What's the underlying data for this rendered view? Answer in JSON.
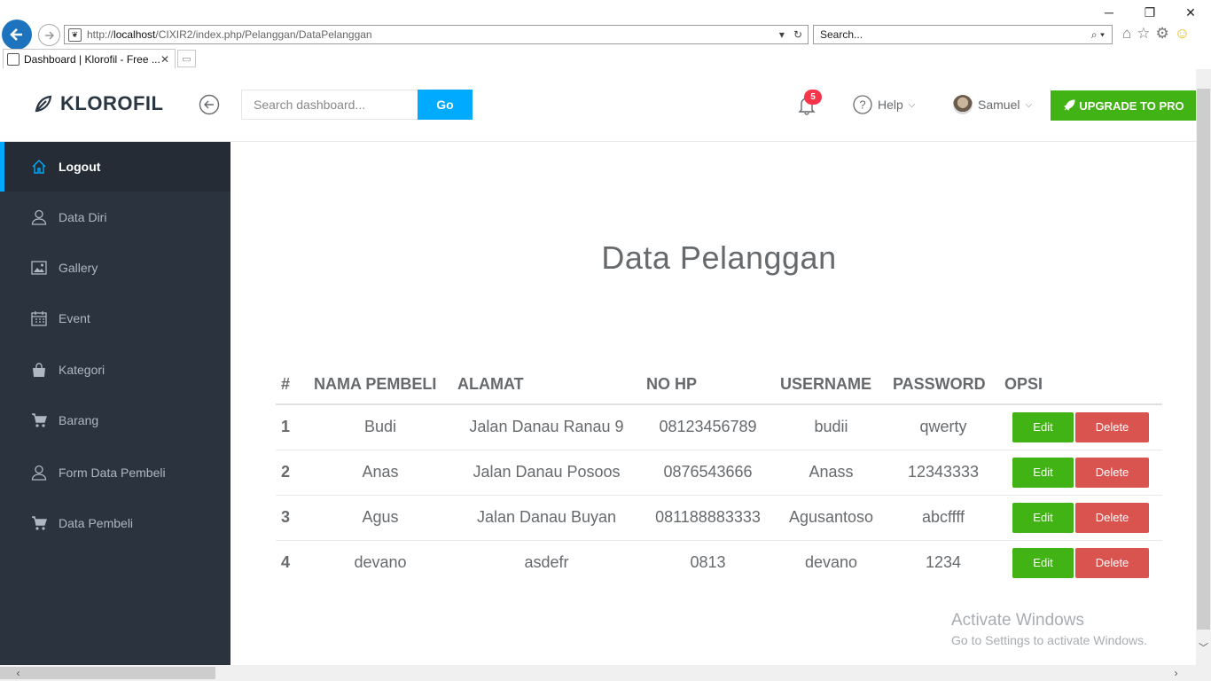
{
  "browser": {
    "url_prefix": "http://",
    "url_host": "localhost",
    "url_path": "/CIXIR2/index.php/Pelanggan/DataPelanggan",
    "search_placeholder": "Search...",
    "tab_title": "Dashboard | Klorofil - Free ...",
    "win_min": "─",
    "win_max": "❐",
    "win_close": "✕",
    "addr_dropdown": "▾",
    "addr_refresh": "↻",
    "search_glyph": "⌕ ▾",
    "tab_close": "✕",
    "newtab_glyph": "▭"
  },
  "navbar": {
    "brand": "KLOROFIL",
    "search_placeholder": "Search dashboard...",
    "go_label": "Go",
    "notification_count": "5",
    "help_label": "Help",
    "user_name": "Samuel",
    "upgrade_label": "UPGRADE TO PRO",
    "chevron": "⌵"
  },
  "sidebar": {
    "items": [
      {
        "label": "Logout",
        "icon": "home-icon"
      },
      {
        "label": "Data Diri",
        "icon": "user-icon"
      },
      {
        "label": "Gallery",
        "icon": "image-icon"
      },
      {
        "label": "Event",
        "icon": "calendar-icon"
      },
      {
        "label": "Kategori",
        "icon": "bag-icon"
      },
      {
        "label": "Barang",
        "icon": "cart-icon"
      },
      {
        "label": "Form Data Pembeli",
        "icon": "user-icon"
      },
      {
        "label": "Data Pembeli",
        "icon": "cart-icon"
      }
    ]
  },
  "main": {
    "title": "Data Pelanggan",
    "table": {
      "headers": [
        "#",
        "NAMA PEMBELI",
        "ALAMAT",
        "NO HP",
        "USERNAME",
        "PASSWORD",
        "OPSI"
      ],
      "rows": [
        {
          "no": "1",
          "nama": "Budi",
          "alamat": "Jalan Danau Ranau 9",
          "hp": "08123456789",
          "username": "budii",
          "password": "qwerty"
        },
        {
          "no": "2",
          "nama": "Anas",
          "alamat": "Jalan Danau Posoos",
          "hp": "0876543666",
          "username": "Anass",
          "password": "12343333"
        },
        {
          "no": "3",
          "nama": "Agus",
          "alamat": "Jalan Danau Buyan",
          "hp": "081188883333",
          "username": "Agusantoso",
          "password": "abcffff"
        },
        {
          "no": "4",
          "nama": "devano",
          "alamat": "asdefr",
          "hp": "0813",
          "username": "devano",
          "password": "1234"
        }
      ],
      "edit_label": "Edit",
      "delete_label": "Delete"
    },
    "watermark": {
      "line1": "Activate Windows",
      "line2": "Go to Settings to activate Windows."
    }
  },
  "colors": {
    "accent": "#00aaff",
    "success": "#41b314",
    "danger": "#d9534f",
    "sidebar_bg": "#2b333e",
    "badge": "#f9354c"
  }
}
